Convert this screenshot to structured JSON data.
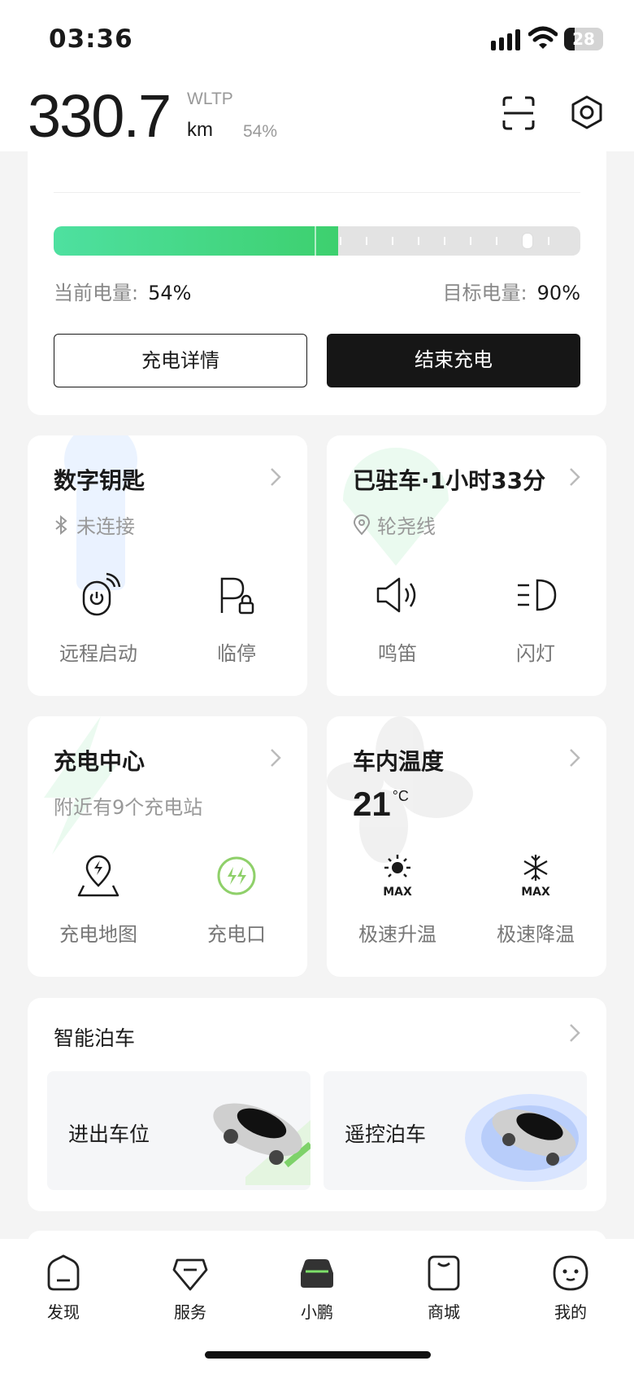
{
  "status_bar": {
    "time": "03:36",
    "battery": "28"
  },
  "header": {
    "range": "330.7",
    "standard": "WLTP",
    "unit": "km",
    "soc": "54%"
  },
  "charging": {
    "current_label": "当前电量:",
    "current_value": "54%",
    "current_level": 0.54,
    "target_label": "目标电量:",
    "target_value": "90%",
    "target_level": 0.9,
    "details_button": "充电详情",
    "stop_button": "结束充电"
  },
  "digital_key": {
    "title": "数字钥匙",
    "status": "未连接",
    "actions": [
      "远程启动",
      "临停"
    ]
  },
  "parking": {
    "title": "已驻车·1小时33分",
    "location": "轮尧线",
    "actions": [
      "鸣笛",
      "闪灯"
    ]
  },
  "charging_center": {
    "title": "充电中心",
    "subtitle": "附近有9个充电站",
    "actions": [
      "充电地图",
      "充电口"
    ]
  },
  "cabin_temp": {
    "title": "车内温度",
    "value": "21",
    "unit": "°C",
    "actions": [
      "极速升温",
      "极速降温"
    ],
    "icon_label": "MAX"
  },
  "smart_parking": {
    "title": "智能泊车",
    "options": [
      "进出车位",
      "遥控泊车"
    ]
  },
  "bottom_nav": [
    "发现",
    "服务",
    "小鹏",
    "商城",
    "我的"
  ],
  "colors": {
    "accent": "#3dd06e",
    "dark_button": "#161616",
    "inactive_bar": "#e3e3e3"
  }
}
